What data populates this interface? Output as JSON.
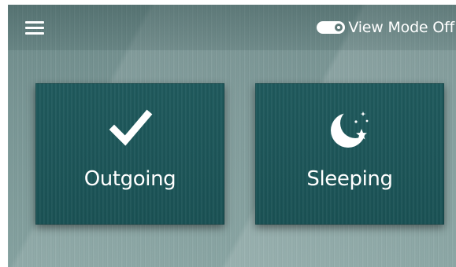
{
  "header": {
    "menu_icon": "hamburger-menu-icon",
    "view_mode": {
      "label": "View Mode Off",
      "toggle_on": false,
      "toggle_icon": "toggle-switch-icon"
    }
  },
  "tiles": [
    {
      "label": "Outgoing",
      "icon": "checkmark-icon"
    },
    {
      "label": "Sleeping",
      "icon": "moon-stars-icon"
    }
  ],
  "colors": {
    "background": "#7a9796",
    "tile": "#1f5a5d",
    "foreground": "#ffffff"
  }
}
